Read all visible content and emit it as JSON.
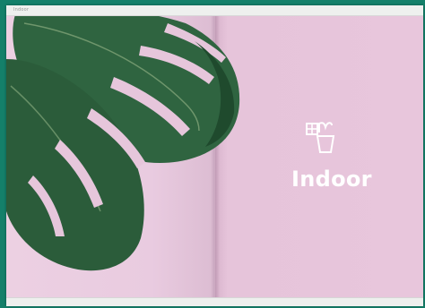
{
  "page": {
    "title": "Indoor",
    "header_left": "Indoor",
    "header_right": "",
    "body_lines": [
      "",
      "",
      ""
    ],
    "page_number_left": "",
    "page_number_right": ""
  },
  "colors": {
    "background_green": "#14806a",
    "page_pink": "#e8c6dc",
    "leaf_green": "#2d5a3a",
    "text_white": "#ffffff"
  },
  "icons": [
    "plant-pot-icon"
  ]
}
